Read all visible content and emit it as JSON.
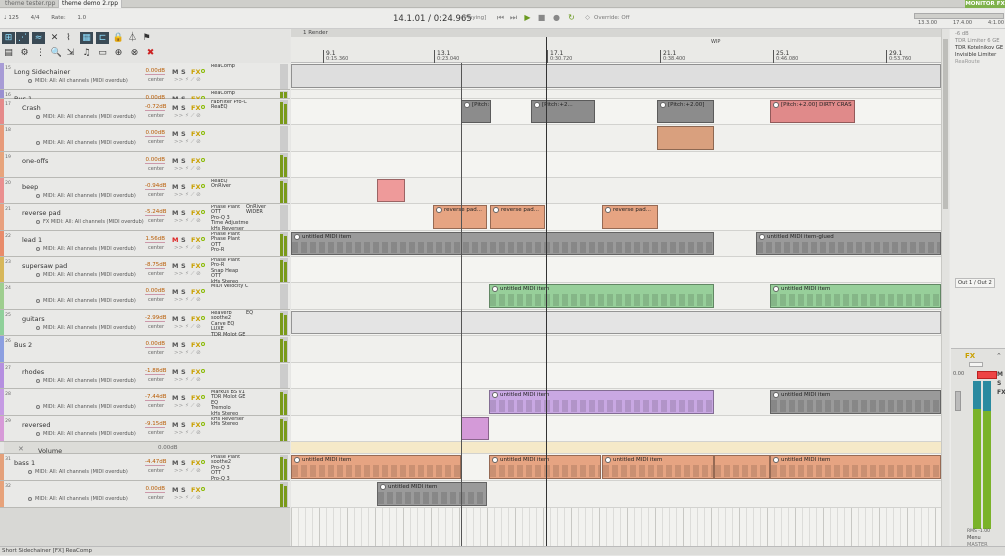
{
  "tabs": [
    {
      "label": "theme tester.rpp",
      "active": false
    },
    {
      "label": "theme demo 2.rpp",
      "active": true
    }
  ],
  "monitor_fx": "MONITOR FX",
  "transport": {
    "bpm": "♩ 125",
    "time_sig": "4/4",
    "rate_label": "Rate:",
    "rate_value": "1.0",
    "position": "14.1.01 / 0:24.965",
    "play_state": "[Playing]",
    "override": "Override: Off",
    "mini_ruler": [
      "13.3.00",
      "17.4.00",
      "4:1.00"
    ]
  },
  "arrange": {
    "header": "1 Render",
    "marker": "WIP",
    "bars": [
      {
        "label": "9.1",
        "time": "0:15.360"
      },
      {
        "label": "13.1",
        "time": "0:23.040"
      },
      {
        "label": "17.1",
        "time": "0:30.720"
      },
      {
        "label": "21.1",
        "time": "0:38.400"
      },
      {
        "label": "25.1",
        "time": "0:46.080"
      },
      {
        "label": "29.1",
        "time": "0:53.760"
      }
    ]
  },
  "tracks": [
    {
      "num": "15",
      "name": "Long Sidechainer",
      "vol": "0.00dB",
      "fx": [
        "ReaComp"
      ],
      "midi": "MIDI: All: All channels (MIDI overdub)",
      "color": "#a89cd6",
      "fx_on": true
    },
    {
      "num": "16",
      "name": "Bus 1",
      "vol": "0.00dB",
      "fx": [
        "ReaComp"
      ],
      "midi": "",
      "color": "#9a8fd1",
      "fx_on": true
    },
    {
      "num": "17",
      "name": "Crash",
      "vol": "-0.72dB",
      "fx": [
        "FabFilter Pro-C",
        "ReaEQ"
      ],
      "midi": "MIDI: All: All channels (MIDI overdub)",
      "color": "#e58a8a",
      "fx_on": true
    },
    {
      "num": "18",
      "name": "",
      "vol": "0.00dB",
      "fx": [],
      "midi": "MIDI: All: All channels (MIDI overdub)",
      "color": "#e79a7a",
      "fx_on": true
    },
    {
      "num": "19",
      "name": "one-offs",
      "vol": "0.00dB",
      "fx": [],
      "midi": "",
      "color": "#e7a47c",
      "fx_on": true
    },
    {
      "num": "20",
      "name": "beep",
      "vol": "-0.94dB",
      "fx": [
        "ReaEQ",
        "OnRiver"
      ],
      "midi": "MIDI: All: All channels (MIDI overdub)",
      "color": "#ea8f8f",
      "fx_on": true
    },
    {
      "num": "21",
      "name": "reverse pad",
      "vol": "-5.24dB",
      "fx": [
        "Phase Plant",
        "OTT",
        "Pro-Q 3",
        "Time Adjustme",
        "kHs Reverser"
      ],
      "fx2": [
        "OnRiver",
        "WIDER"
      ],
      "midi": "FX MIDI: All: All channels (MIDI overdub)",
      "color": "#e8a07e",
      "fx_on": true
    },
    {
      "num": "22",
      "name": "lead 1",
      "vol": "1.56dB",
      "fx": [
        "Phase Plant",
        "Phase Plant",
        "OTT",
        "Pro-R"
      ],
      "midi": "MIDI: All: All channels (MIDI overdub)",
      "color": "#e88b6a",
      "fx_on": true,
      "muted": true
    },
    {
      "num": "23",
      "name": "supersaw pad",
      "vol": "-8.75dB",
      "fx": [
        "Phase Plant",
        "Pro-R",
        "Snap Heap",
        "OTT",
        "kHs Stereo"
      ],
      "midi": "MIDI: All: All channels (MIDI overdub)",
      "color": "#d7b75a",
      "fx_on": true
    },
    {
      "num": "24",
      "name": "",
      "vol": "0.00dB",
      "fx": [
        "MIDI Velocity C"
      ],
      "midi": "MIDI: All: All channels (MIDI overdub)",
      "color": "#9fce8f",
      "fx_on": true
    },
    {
      "num": "25",
      "name": "guitars",
      "vol": "-2.99dB",
      "fx": [
        "ReaVerb",
        "soothe2",
        "Carve EQ",
        "LUXE",
        "TDR Molot GE"
      ],
      "fx2": [
        "EQ"
      ],
      "midi": "MIDI: All: All channels (MIDI overdub)",
      "color": "#8fd09a",
      "fx_on": true
    },
    {
      "num": "26",
      "name": "Bus 2",
      "vol": "0.00dB",
      "fx": [],
      "midi": "",
      "color": "#8c9fe0",
      "fx_on": true
    },
    {
      "num": "27",
      "name": "rhodes",
      "vol": "-1.88dB",
      "fx": [],
      "midi": "MIDI: All: All channels (MIDI overdub)",
      "color": "#b58fe0",
      "fx_on": true
    },
    {
      "num": "28",
      "name": "",
      "vol": "-7.44dB",
      "fx": [
        "Markus BS v1",
        "TDR Molot GE",
        "EQ",
        "Tremolo",
        "kHs Stereo"
      ],
      "midi": "MIDI: All: All channels (MIDI overdub)",
      "color": "#c59be3",
      "fx_on": true
    },
    {
      "num": "29",
      "name": "reversed",
      "vol": "-9.15dB",
      "fx": [
        "kHs Reverser",
        "kHs Stereo"
      ],
      "midi": "MIDI: All: All channels (MIDI overdub)",
      "color": "#d79ad8",
      "fx_on": true
    },
    {
      "num": "",
      "name": "Volume",
      "vol": "0.00dB",
      "fx": [],
      "midi": "",
      "color": "#e6e6e4",
      "fx_on": false,
      "envelope": true
    },
    {
      "num": "31",
      "name": "bass 1",
      "vol": "-4.47dB",
      "fx": [
        "Phase Plant",
        "soothe2",
        "Pro-Q 3",
        "OTT",
        "Pro-Q 3"
      ],
      "midi": "MIDI: All: All channels (MIDI overdub)",
      "color": "#e4a07a",
      "fx_on": true
    },
    {
      "num": "32",
      "name": "",
      "vol": "0.00dB",
      "fx": [],
      "midi": "MIDI: All: All channels (MIDI overdub)",
      "color": "#e7a27a",
      "fx_on": true
    }
  ],
  "pan_label": "center",
  "items": {
    "crash_pitch": "[Pitch:+2...",
    "crash_pitch_full": "[Pitch:+2.00]",
    "crash_dirty": "[Pitch:+2.00] DIRTY CRAS",
    "reverse_pad": "reverse pad...",
    "midi_item": "untitled MIDI item",
    "midi_glued": "untitled MIDI item-glued"
  },
  "right_panel": {
    "header": "-6 dB",
    "plugins": [
      "TDR Limiter 6 GE",
      "TDR Kotelnikov GE",
      "Invisible Limiter",
      "ReaRoute"
    ],
    "io": "Out 1 / Out 2",
    "master_fx": "FX",
    "master_vol": "0.00",
    "master_label": "MASTER",
    "menu": "Menu",
    "rms": "RMS  -1.00"
  },
  "status": "Short Sidechainer [FX] ReaComp"
}
